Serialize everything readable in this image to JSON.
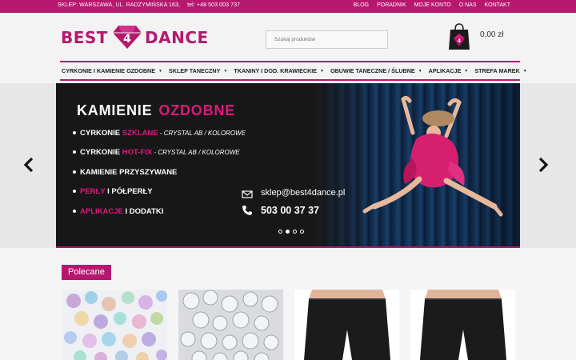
{
  "topbar": {
    "address": "SKLEP: WARSZAWA, UL. RADZYMIŃSKA 163,",
    "phone": "tel: +48 503 003 737",
    "links": [
      "BLOG",
      "PORADNIK",
      "MOJE KONTO",
      "O NAS",
      "KONTAKT"
    ]
  },
  "logo": {
    "word1": "BEST",
    "digit": "4",
    "word2": "DANCE"
  },
  "search": {
    "placeholder": "Szukaj produktów"
  },
  "cart": {
    "total": "0,00 zł",
    "icon": "shopping-bag-icon"
  },
  "nav": {
    "items": [
      "CYRKONIE I KAMIENIE OZDOBNE",
      "SKLEP TANECZNY",
      "TKANINY I DOD. KRAWIECKIE",
      "OBUWIE TANECZNE / ŚLUBNE",
      "APLIKACJE",
      "STREFA MAREK"
    ]
  },
  "slide": {
    "headline_a": "KAMIENIE",
    "headline_b": "OZDOBNE",
    "items": [
      {
        "a": "CYRKONIE ",
        "pink": "SZKLANE",
        "sub": " - CRYSTAL AB / KOLOROWE"
      },
      {
        "a": "CYRKONIE ",
        "pink": "HOT-FIX",
        "sub": " - CRYSTAL AB / KOLOROWE"
      },
      {
        "a": "KAMIENIE PRZYSZYWANE",
        "pink": "",
        "sub": ""
      },
      {
        "a": "",
        "pink": "PERŁY",
        "b": " I PÓŁPERŁY"
      },
      {
        "a": "",
        "pink": "APLIKACJE",
        "b": " I DODATKI"
      }
    ],
    "email": "sklep@best4dance.pl",
    "phone": "503 00 37 37",
    "active_dot": 2,
    "dot_count": 4
  },
  "section": {
    "title": "Polecane"
  },
  "colors": {
    "brand": "#b5196e",
    "accent_pink": "#e0177d",
    "curtain": "#123154"
  }
}
